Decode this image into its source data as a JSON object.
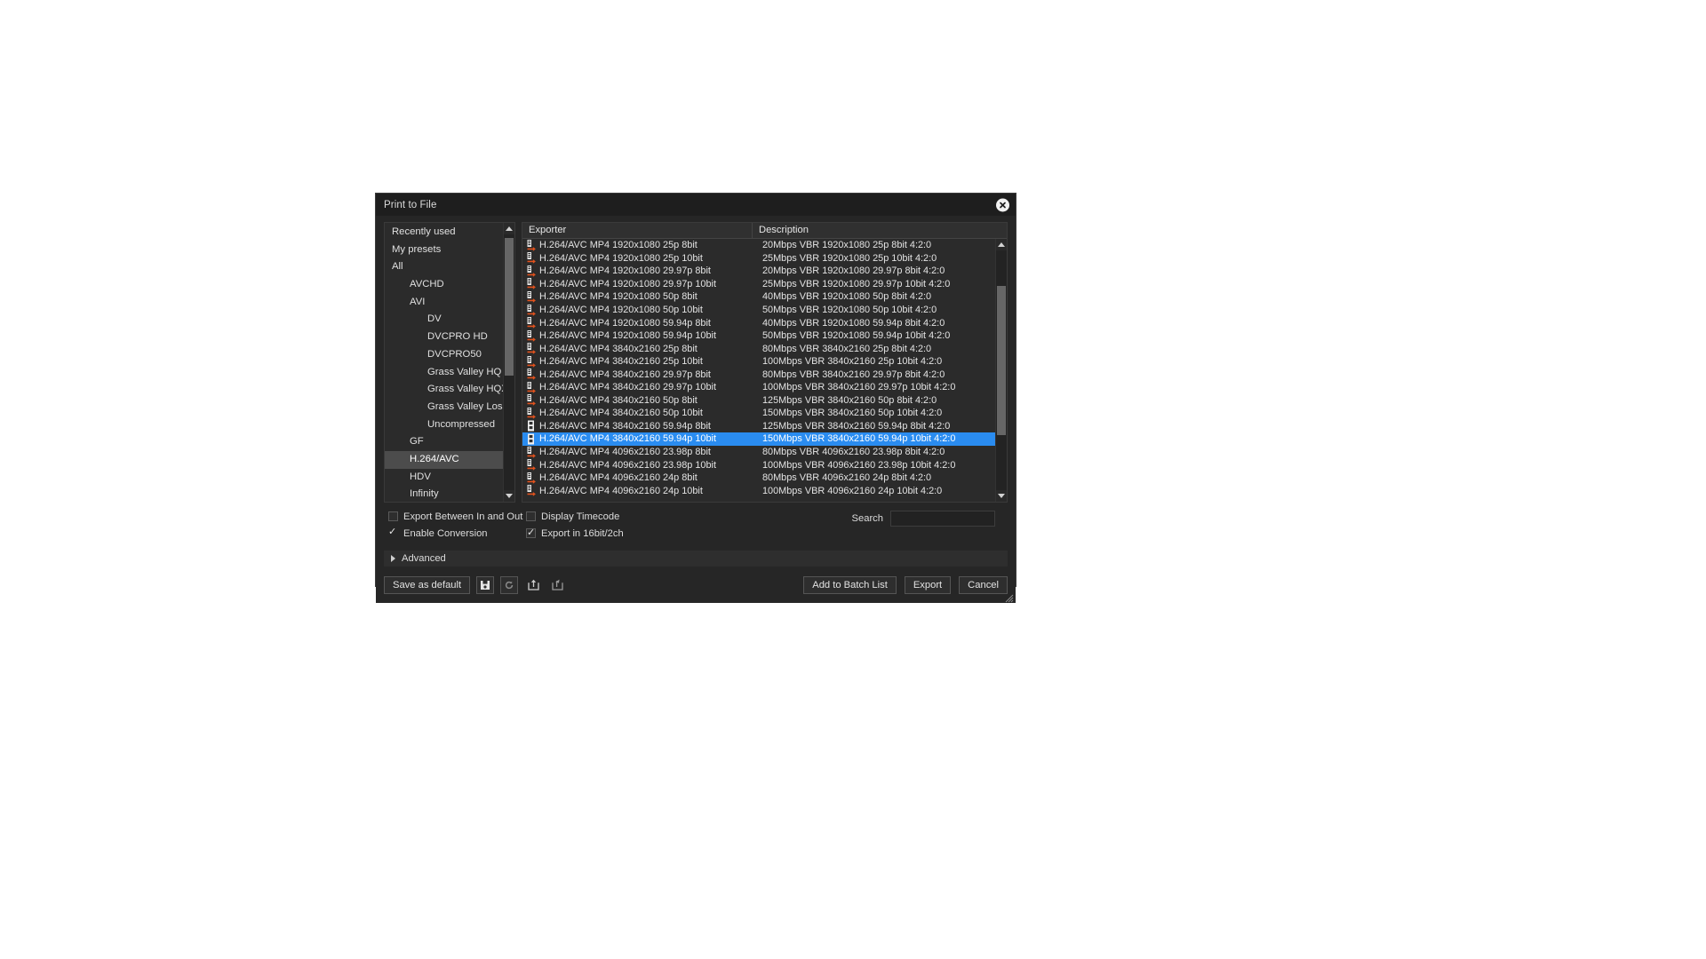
{
  "window": {
    "title": "Print to File",
    "close_icon": "close-icon"
  },
  "sidebar": {
    "items": [
      {
        "label": "Recently used",
        "depth": 1,
        "selected": false
      },
      {
        "label": "My presets",
        "depth": 1,
        "selected": false
      },
      {
        "label": "All",
        "depth": 1,
        "selected": false
      },
      {
        "label": "AVCHD",
        "depth": 2,
        "selected": false
      },
      {
        "label": "AVI",
        "depth": 2,
        "selected": false
      },
      {
        "label": "DV",
        "depth": 3,
        "selected": false
      },
      {
        "label": "DVCPRO HD",
        "depth": 3,
        "selected": false
      },
      {
        "label": "DVCPRO50",
        "depth": 3,
        "selected": false
      },
      {
        "label": "Grass Valley HQ",
        "depth": 3,
        "selected": false
      },
      {
        "label": "Grass Valley HQX",
        "depth": 3,
        "selected": false
      },
      {
        "label": "Grass Valley Lossless",
        "depth": 3,
        "selected": false
      },
      {
        "label": "Uncompressed",
        "depth": 3,
        "selected": false
      },
      {
        "label": "GF",
        "depth": 2,
        "selected": false
      },
      {
        "label": "H.264/AVC",
        "depth": 2,
        "selected": true
      },
      {
        "label": "HDV",
        "depth": 2,
        "selected": false
      },
      {
        "label": "Infinity",
        "depth": 2,
        "selected": false
      }
    ]
  },
  "list": {
    "columns": {
      "exporter": "Exporter",
      "description": "Description"
    },
    "rows": [
      {
        "icon": "exporter-arrow-icon",
        "name": "H.264/AVC MP4 1920x1080 25p 8bit",
        "desc": "20Mbps VBR  1920x1080 25p 8bit 4:2:0",
        "selected": false
      },
      {
        "icon": "exporter-arrow-icon",
        "name": "H.264/AVC MP4 1920x1080 25p 10bit",
        "desc": "25Mbps VBR  1920x1080 25p 10bit 4:2:0",
        "selected": false
      },
      {
        "icon": "exporter-arrow-icon",
        "name": "H.264/AVC MP4 1920x1080 29.97p 8bit",
        "desc": "20Mbps VBR  1920x1080 29.97p 8bit 4:2:0",
        "selected": false
      },
      {
        "icon": "exporter-arrow-icon",
        "name": "H.264/AVC MP4 1920x1080 29.97p 10bit",
        "desc": "25Mbps VBR  1920x1080 29.97p 10bit 4:2:0",
        "selected": false
      },
      {
        "icon": "exporter-arrow-icon",
        "name": "H.264/AVC MP4 1920x1080 50p 8bit",
        "desc": "40Mbps VBR  1920x1080 50p 8bit 4:2:0",
        "selected": false
      },
      {
        "icon": "exporter-arrow-icon",
        "name": "H.264/AVC MP4 1920x1080 50p 10bit",
        "desc": "50Mbps VBR  1920x1080 50p 10bit 4:2:0",
        "selected": false
      },
      {
        "icon": "exporter-arrow-icon",
        "name": "H.264/AVC MP4 1920x1080 59.94p 8bit",
        "desc": "40Mbps VBR  1920x1080 59.94p 8bit 4:2:0",
        "selected": false
      },
      {
        "icon": "exporter-arrow-icon",
        "name": "H.264/AVC MP4 1920x1080 59.94p 10bit",
        "desc": "50Mbps VBR  1920x1080 59.94p 10bit 4:2:0",
        "selected": false
      },
      {
        "icon": "exporter-arrow-icon",
        "name": "H.264/AVC MP4 3840x2160 25p 8bit",
        "desc": "80Mbps VBR  3840x2160 25p 8bit 4:2:0",
        "selected": false
      },
      {
        "icon": "exporter-arrow-icon",
        "name": "H.264/AVC MP4 3840x2160 25p 10bit",
        "desc": "100Mbps VBR  3840x2160 25p 10bit 4:2:0",
        "selected": false
      },
      {
        "icon": "exporter-arrow-icon",
        "name": "H.264/AVC MP4 3840x2160 29.97p 8bit",
        "desc": "80Mbps VBR  3840x2160 29.97p 8bit 4:2:0",
        "selected": false
      },
      {
        "icon": "exporter-arrow-icon",
        "name": "H.264/AVC MP4 3840x2160 29.97p 10bit",
        "desc": "100Mbps VBR  3840x2160 29.97p 10bit 4:2:0",
        "selected": false
      },
      {
        "icon": "exporter-arrow-icon",
        "name": "H.264/AVC MP4 3840x2160 50p 8bit",
        "desc": "125Mbps VBR  3840x2160 50p 8bit 4:2:0",
        "selected": false
      },
      {
        "icon": "exporter-arrow-icon",
        "name": "H.264/AVC MP4 3840x2160 50p 10bit",
        "desc": "150Mbps VBR  3840x2160 50p 10bit 4:2:0",
        "selected": false
      },
      {
        "icon": "filmstrip-icon",
        "name": "H.264/AVC MP4 3840x2160 59.94p 8bit",
        "desc": "125Mbps VBR  3840x2160 59.94p 8bit 4:2:0",
        "selected": false
      },
      {
        "icon": "filmstrip-icon",
        "name": "H.264/AVC MP4 3840x2160 59.94p 10bit",
        "desc": "150Mbps VBR  3840x2160 59.94p 10bit 4:2:0",
        "selected": true
      },
      {
        "icon": "exporter-arrow-icon",
        "name": "H.264/AVC MP4 4096x2160 23.98p 8bit",
        "desc": "80Mbps VBR  4096x2160 23.98p 8bit 4:2:0",
        "selected": false
      },
      {
        "icon": "exporter-arrow-icon",
        "name": "H.264/AVC MP4 4096x2160 23.98p 10bit",
        "desc": "100Mbps VBR  4096x2160 23.98p 10bit 4:2:0",
        "selected": false
      },
      {
        "icon": "exporter-arrow-icon",
        "name": "H.264/AVC MP4 4096x2160 24p 8bit",
        "desc": "80Mbps VBR  4096x2160 24p 8bit 4:2:0",
        "selected": false
      },
      {
        "icon": "exporter-arrow-icon",
        "name": "H.264/AVC MP4 4096x2160 24p 10bit",
        "desc": "100Mbps VBR  4096x2160 24p 10bit 4:2:0",
        "selected": false
      }
    ]
  },
  "options": {
    "export_between_in_and_out": {
      "label": "Export Between In and Out",
      "checked": false
    },
    "enable_conversion": {
      "label": "Enable Conversion",
      "checked": true
    },
    "display_timecode": {
      "label": "Display Timecode",
      "checked": false
    },
    "export_16bit_2ch": {
      "label": "Export in 16bit/2ch",
      "checked": true
    },
    "search": {
      "label": "Search",
      "value": "",
      "placeholder": ""
    },
    "advanced": {
      "label": "Advanced",
      "expanded": false
    }
  },
  "footer": {
    "save_as_default": "Save as default",
    "icon_buttons": [
      {
        "name": "save-preset-icon"
      },
      {
        "name": "reset-preset-icon"
      },
      {
        "name": "import-preset-icon"
      },
      {
        "name": "export-preset-icon"
      }
    ],
    "add_to_batch_list": "Add to Batch List",
    "export": "Export",
    "cancel": "Cancel"
  },
  "colors": {
    "selection_blue": "#2a8cf0",
    "dialog_bg": "#262626",
    "pane_bg": "#2b2b2b",
    "accent_orange": "#e2521d"
  }
}
